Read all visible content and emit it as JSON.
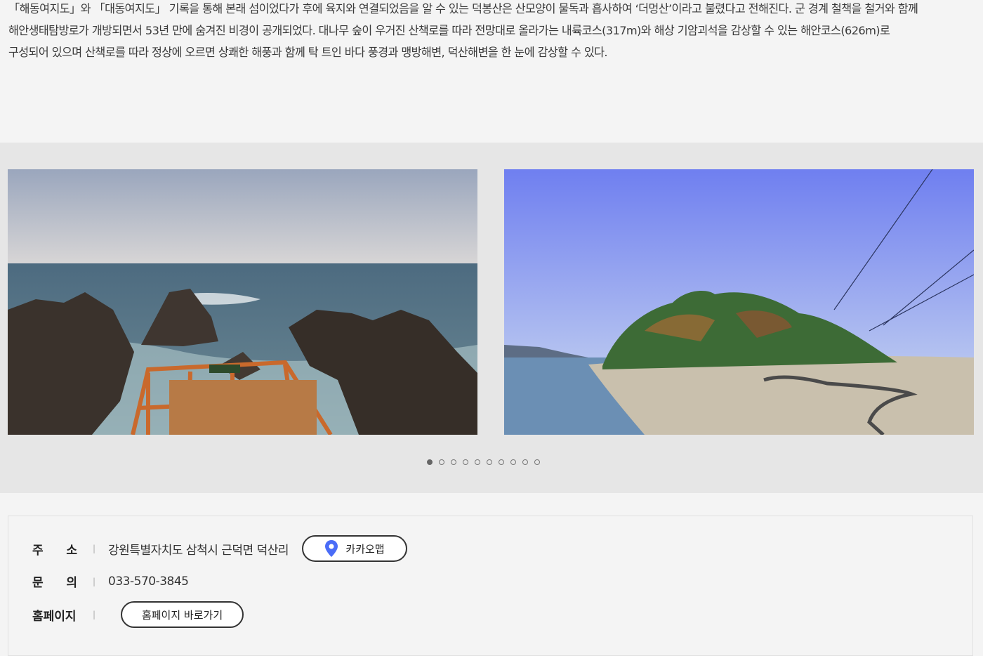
{
  "intro": {
    "line1": "「해동여지도」와 「대동여지도」 기록을 통해 본래 섬이었다가 후에 육지와 연결되었음을 알 수 있는 덕봉산은 산모양이 물독과 흡사하여 ‘더멍산’이라고 불렸다고 전해진다. 군 경계 철책을 철거와 함께",
    "line2": "해안생태탐방로가 개방되면서 53년 만에 숨겨진 비경이 공개되었다. 대나무 숲이 우거진 산책로를 따라 전망대로 올라가는 내륙코스(317m)와 해상 기암괴석을 감상할 수 있는 해안코스(626m)로",
    "line3": "구성되어 있으며 산책로를 따라 정상에 오르면 상쾌한 해풍과 함께 탁 트인 바다 풍경과 맹방해변, 덕산해변을 한 눈에 감상할 수 있다."
  },
  "gallery": {
    "slide_count": 10,
    "active_index": 0
  },
  "info": {
    "address": {
      "label_a": "주",
      "label_b": "소",
      "value": "강원특별자치도 삼척시 근덕면 덕산리",
      "map_button": "카카오맵"
    },
    "contact": {
      "label_a": "문",
      "label_b": "의",
      "value": "033-570-3845"
    },
    "homepage": {
      "label": "홈페이지",
      "button": "홈페이지 바로가기"
    },
    "separator": "|"
  },
  "colors": {
    "map_pin": "#4a6cf7",
    "gallery_bg": "#e6e6e6"
  }
}
